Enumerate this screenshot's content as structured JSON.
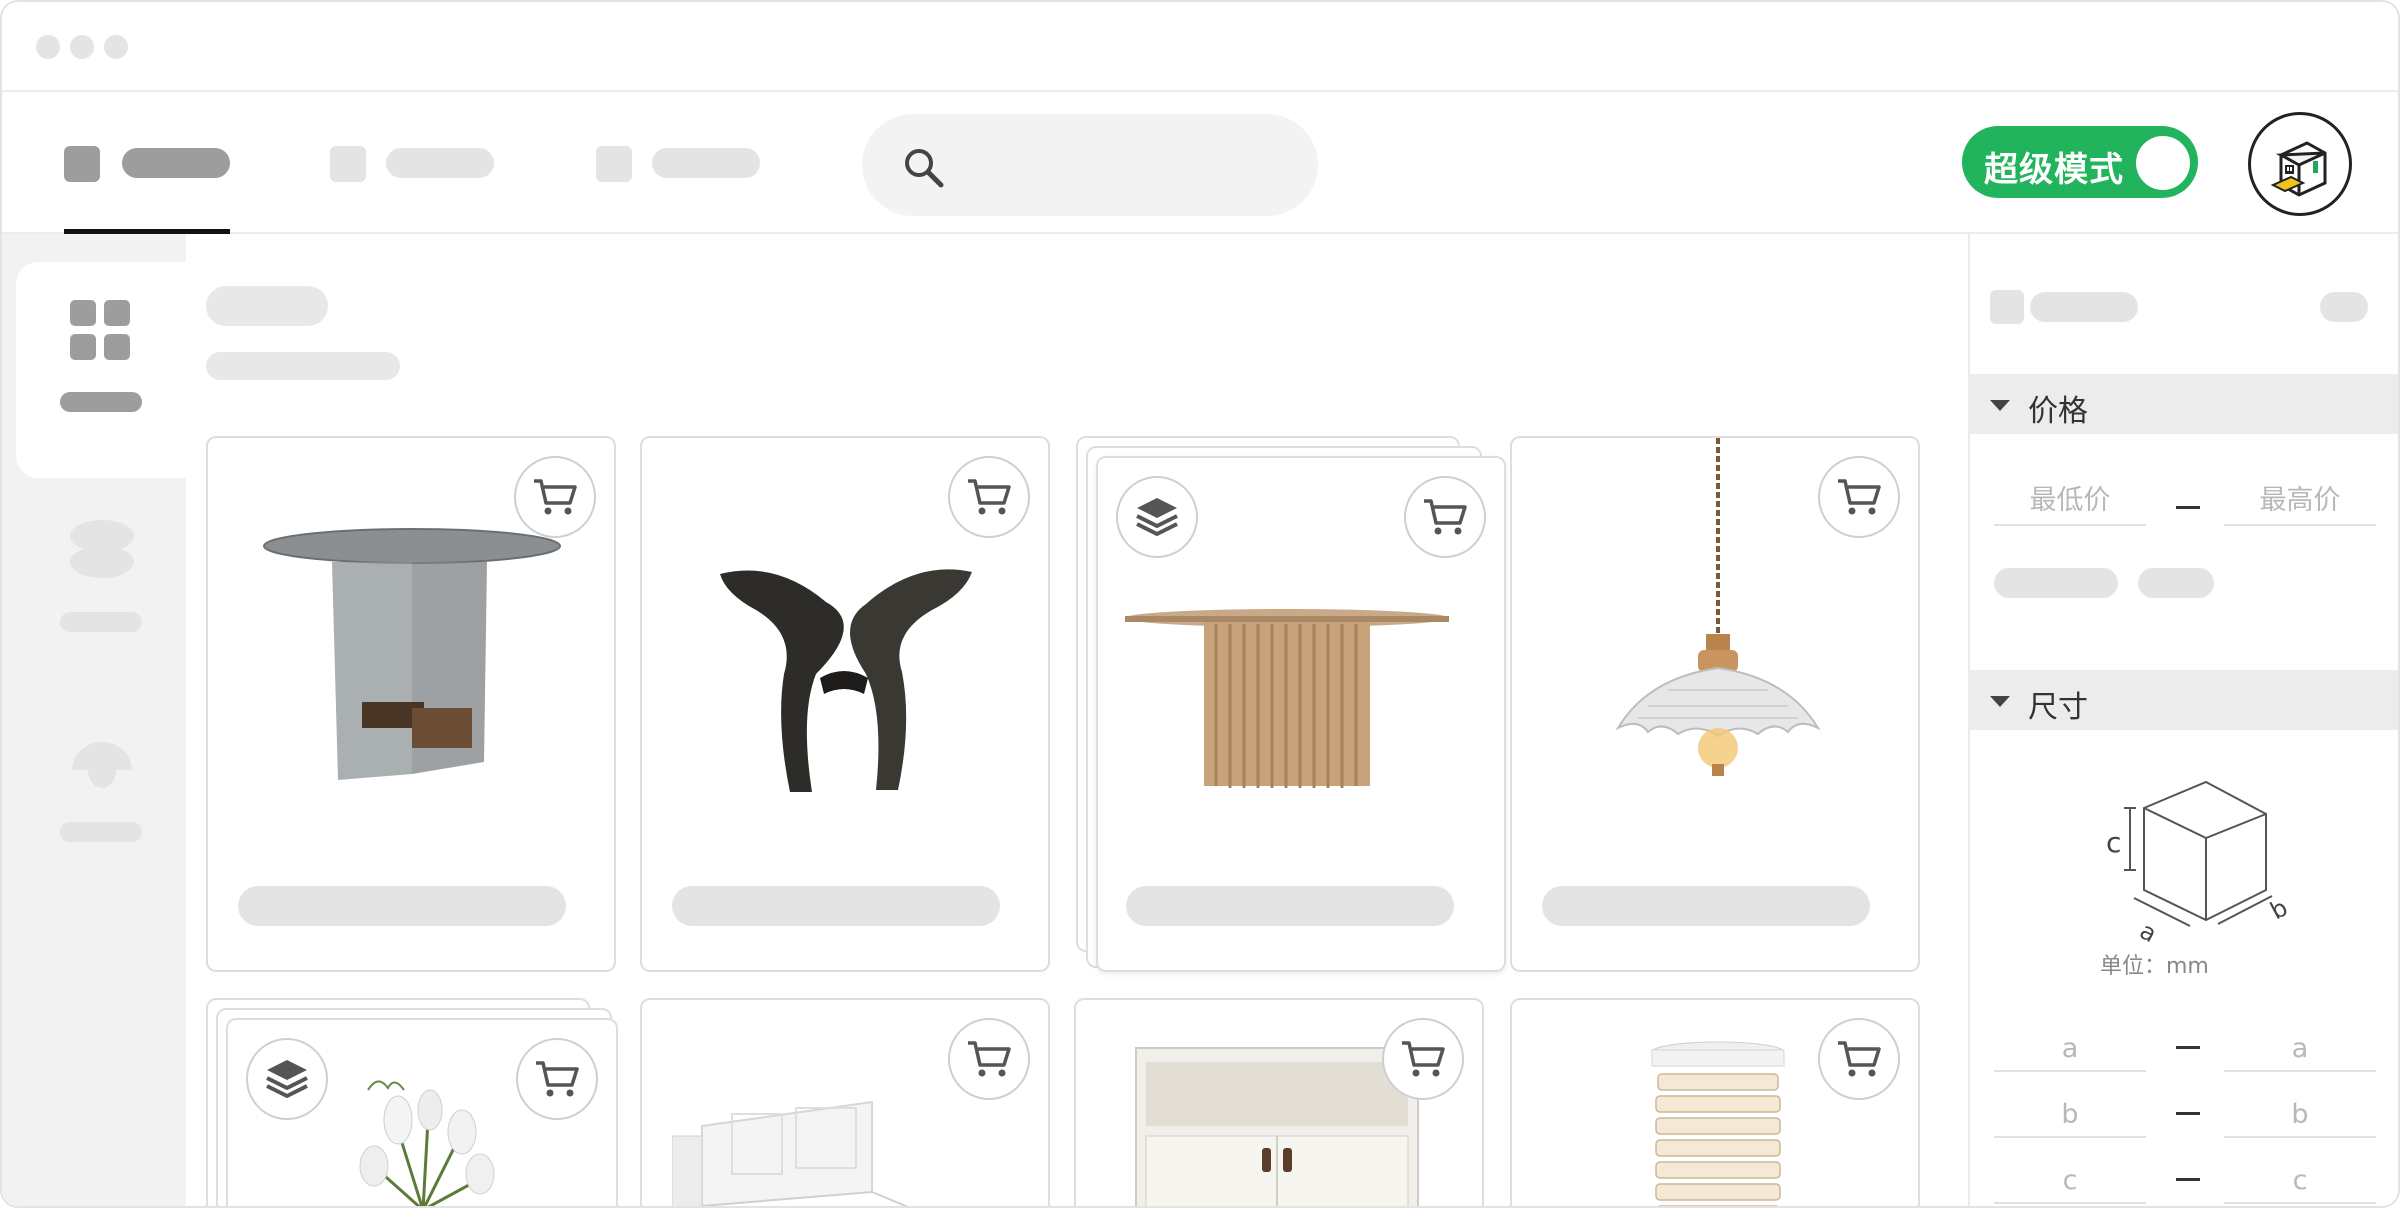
{
  "window": {
    "traffic_lights": [
      "close",
      "minimize",
      "zoom"
    ]
  },
  "header": {
    "tabs": [
      {
        "active": true
      },
      {
        "active": false
      },
      {
        "active": false
      }
    ],
    "search_placeholder": "",
    "toggle_label": "超级模式",
    "toggle_on": true
  },
  "sidebar": {
    "items": [
      {
        "icon": "grid-icon",
        "active": true
      },
      {
        "icon": "stack-icon",
        "active": false
      },
      {
        "icon": "mushroom-icon",
        "active": false
      }
    ]
  },
  "filters": {
    "price": {
      "title": "价格",
      "min_placeholder": "最低价",
      "max_placeholder": "最高价"
    },
    "size": {
      "title": "尺寸",
      "diagram_label_c": "c",
      "diagram_label_a": "a",
      "diagram_label_b": "b",
      "unit": "单位：mm",
      "rows": [
        {
          "min": "a",
          "max": "a"
        },
        {
          "min": "b",
          "max": "b"
        },
        {
          "min": "c",
          "max": "c"
        }
      ]
    }
  },
  "products": [
    {
      "name": "glass side table",
      "stacked": false
    },
    {
      "name": "butterfly stool",
      "stacked": false
    },
    {
      "name": "fluted round table",
      "stacked": true
    },
    {
      "name": "glass pendant lamp",
      "stacked": false
    },
    {
      "name": "tulip vase",
      "stacked": true
    },
    {
      "name": "white bed",
      "stacked": false
    },
    {
      "name": "white sideboard",
      "stacked": false
    },
    {
      "name": "pleated floor lamp",
      "stacked": false
    }
  ]
}
